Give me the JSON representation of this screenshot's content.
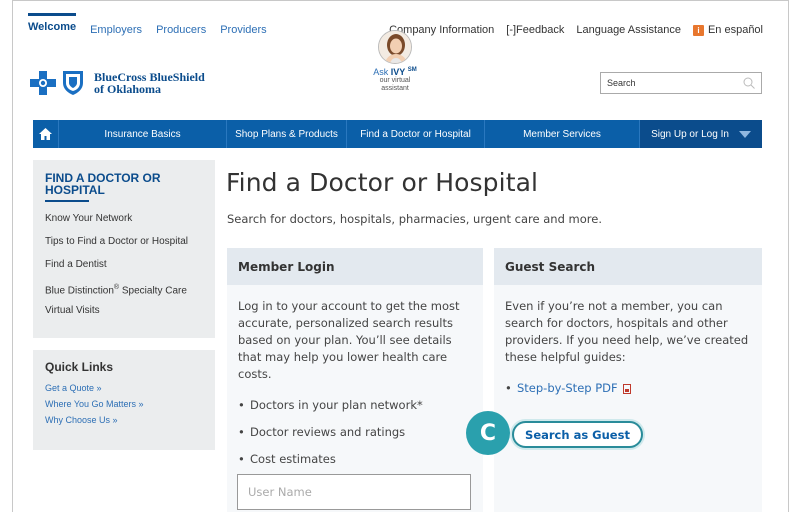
{
  "top_nav": {
    "items": [
      "Welcome",
      "Employers",
      "Producers",
      "Providers"
    ]
  },
  "utility_nav": {
    "company_info": "Company Information",
    "feedback": "Feedback",
    "language": "Language Assistance",
    "espanol": "En español"
  },
  "logo": {
    "line1": "BlueCross BlueShield",
    "line2": "of Oklahoma"
  },
  "ivy": {
    "label_prefix": "Ask ",
    "label_name": "IVY",
    "label_mark": "SM",
    "sub1": "our virtual",
    "sub2": "assistant"
  },
  "search": {
    "placeholder": "Search"
  },
  "main_nav": {
    "items": [
      "Insurance Basics",
      "Shop Plans & Products",
      "Find a Doctor or Hospital",
      "Member Services"
    ],
    "signup": "Sign Up or Log In"
  },
  "sidebar": {
    "title": "FIND A DOCTOR OR HOSPITAL",
    "items": [
      "Know Your Network",
      "Tips to Find a Doctor or Hospital",
      "Find a Dentist",
      "Blue Distinction",
      "Specialty Care",
      "Virtual Visits"
    ]
  },
  "quick_links": {
    "title": "Quick Links",
    "items": [
      "Get a Quote »",
      "Where You Go Matters »",
      "Why Choose Us »"
    ]
  },
  "main": {
    "title": "Find a Doctor or Hospital",
    "description": "Search for doctors, hospitals, pharmacies, urgent care and more."
  },
  "member_login": {
    "title": "Member Login",
    "body": "Log in to your account to get the most accurate, personalized search results based on your plan. You’ll see details that may help you lower health care costs.",
    "bullets": [
      "Doctors in your plan network*",
      "Doctor reviews and ratings",
      "Cost estimates"
    ],
    "username_placeholder": "User Name"
  },
  "guest_search": {
    "title": "Guest Search",
    "body": "Even if you’re not a member, you can search for doctors, hospitals and other providers. If you need help, we’ve created these helpful guides:",
    "pdf_link": "Step-by-Step PDF",
    "button": "Search as Guest"
  },
  "badge": "C",
  "colors": {
    "brand_blue": "#0b5fa8",
    "dark_blue": "#0b4c8c",
    "teal": "#2aa0ad",
    "orange": "#e8772e"
  }
}
